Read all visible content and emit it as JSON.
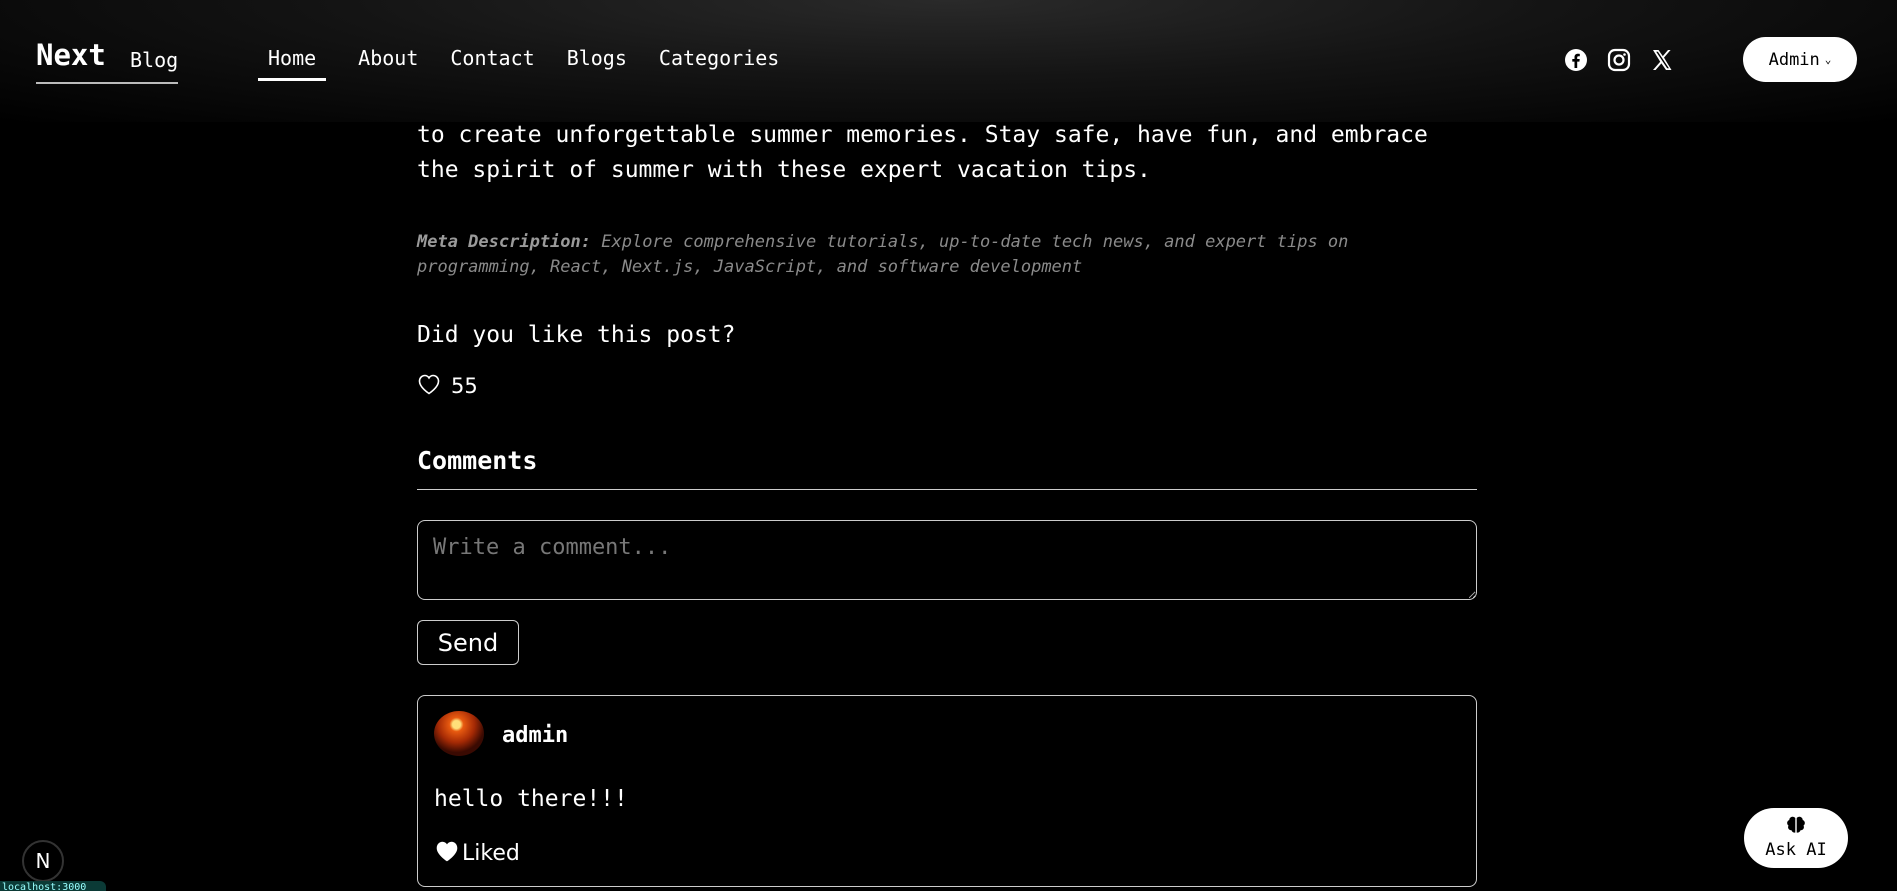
{
  "header": {
    "brand_title": "Next",
    "brand_sub": "Blog",
    "nav": [
      {
        "label": "Home",
        "active": true
      },
      {
        "label": "About",
        "active": false
      },
      {
        "label": "Contact",
        "active": false
      },
      {
        "label": "Blogs",
        "active": false
      },
      {
        "label": "Categories",
        "active": false
      }
    ],
    "social_icons": [
      "facebook-icon",
      "instagram-icon",
      "x-icon"
    ],
    "admin_label": "Admin"
  },
  "article": {
    "text": "to create unforgettable summer memories. Stay safe, have fun, and embrace the spirit of summer with these expert vacation tips.",
    "meta_label": "Meta Description:",
    "meta_text": "Explore comprehensive tutorials, up-to-date tech news, and expert tips on programming, React, Next.js, JavaScript, and software development"
  },
  "likes": {
    "question": "Did you like this post?",
    "count": "55"
  },
  "comments": {
    "title": "Comments",
    "placeholder": "Write a comment...",
    "send_label": "Send",
    "items": [
      {
        "author": "admin",
        "body": "hello there!!!",
        "liked_label": "Liked"
      }
    ]
  },
  "ask_ai_label": "Ask AI",
  "next_badge": "N",
  "localhost": "localhost:3000",
  "colors": {
    "background": "#000000",
    "text": "#ffffff",
    "muted": "#8a8a8a",
    "border": "#cccccc"
  }
}
